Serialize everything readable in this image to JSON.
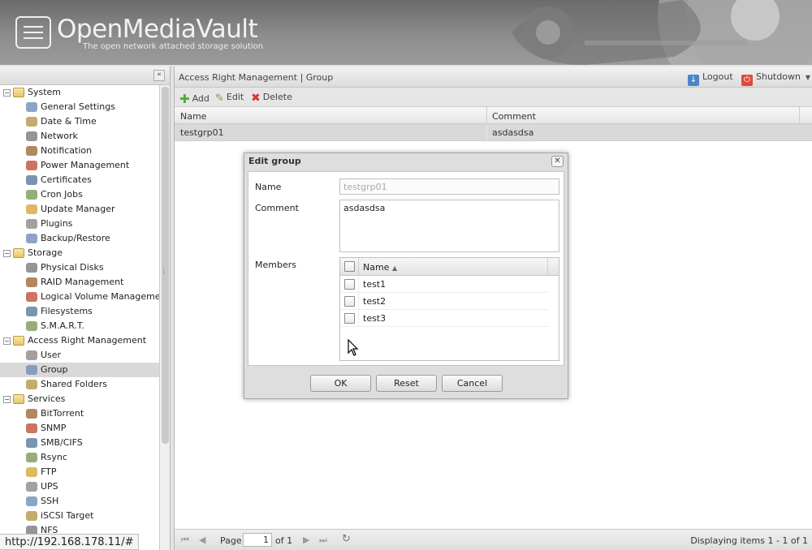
{
  "app": {
    "logo_title": "OpenMediaVault",
    "logo_subtitle": "The open network attached storage solution"
  },
  "sidebar": {
    "collapse_icon": "double-chevron-left-icon",
    "items": [
      {
        "label": "System",
        "level": 0,
        "expanded": true
      },
      {
        "label": "General Settings",
        "level": 1
      },
      {
        "label": "Date & Time",
        "level": 1
      },
      {
        "label": "Network",
        "level": 1
      },
      {
        "label": "Notification",
        "level": 1
      },
      {
        "label": "Power Management",
        "level": 1
      },
      {
        "label": "Certificates",
        "level": 1
      },
      {
        "label": "Cron Jobs",
        "level": 1
      },
      {
        "label": "Update Manager",
        "level": 1
      },
      {
        "label": "Plugins",
        "level": 1
      },
      {
        "label": "Backup/Restore",
        "level": 1
      },
      {
        "label": "Storage",
        "level": 0,
        "expanded": true
      },
      {
        "label": "Physical Disks",
        "level": 1
      },
      {
        "label": "RAID Management",
        "level": 1
      },
      {
        "label": "Logical Volume Management",
        "level": 1
      },
      {
        "label": "Filesystems",
        "level": 1
      },
      {
        "label": "S.M.A.R.T.",
        "level": 1
      },
      {
        "label": "Access Right Management",
        "level": 0,
        "expanded": true
      },
      {
        "label": "User",
        "level": 1
      },
      {
        "label": "Group",
        "level": 1,
        "selected": true
      },
      {
        "label": "Shared Folders",
        "level": 1
      },
      {
        "label": "Services",
        "level": 0,
        "expanded": true
      },
      {
        "label": "BitTorrent",
        "level": 1
      },
      {
        "label": "SNMP",
        "level": 1
      },
      {
        "label": "SMB/CIFS",
        "level": 1
      },
      {
        "label": "Rsync",
        "level": 1
      },
      {
        "label": "FTP",
        "level": 1
      },
      {
        "label": "UPS",
        "level": 1
      },
      {
        "label": "SSH",
        "level": 1
      },
      {
        "label": "iSCSI Target",
        "level": 1
      },
      {
        "label": "NFS",
        "level": 1
      }
    ]
  },
  "main": {
    "breadcrumb": "Access Right Management | Group",
    "logout_label": "Logout",
    "shutdown_label": "Shutdown",
    "toolbar": {
      "add_label": "Add",
      "edit_label": "Edit",
      "delete_label": "Delete"
    },
    "grid": {
      "columns": [
        "Name",
        "Comment"
      ],
      "rows": [
        {
          "name": "testgrp01",
          "comment": "asdasdsa"
        }
      ]
    },
    "pager": {
      "page_label": "Page",
      "page_value": "1",
      "of_label": "of 1",
      "display_text": "Displaying items 1 - 1 of 1"
    }
  },
  "status_url": "http://192.168.178.11/#",
  "dialog": {
    "title": "Edit group",
    "name_label": "Name",
    "name_value": "testgrp01",
    "comment_label": "Comment",
    "comment_value": "asdasdsa",
    "members_label": "Members",
    "members_column": "Name",
    "members": [
      "test1",
      "test2",
      "test3"
    ],
    "ok_label": "OK",
    "reset_label": "Reset",
    "cancel_label": "Cancel"
  },
  "colors": {
    "header_bg": "#8d8d8d",
    "selected_row": "#d9d9d9",
    "add_icon": "#4caf2f",
    "delete_icon": "#d23a2a",
    "shutdown_icon": "#e04a3a",
    "logout_icon": "#4a86c8"
  }
}
